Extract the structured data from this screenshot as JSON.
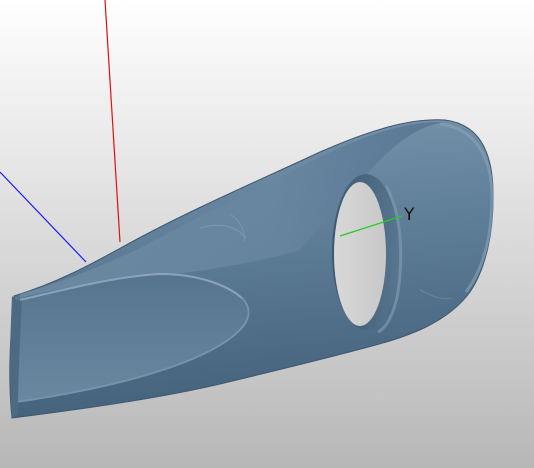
{
  "viewport": {
    "background_top": "#ffffff",
    "background_bottom": "#b8b8b8",
    "model_color": "#5f7e98",
    "model_shadow_color": "#3f5a72",
    "model_highlight_color": "#8ea8bf"
  },
  "axes": {
    "x_axis": {
      "color": "#e01010",
      "label": ""
    },
    "y_axis": {
      "color": "#22cc22",
      "label": "Y"
    },
    "z_axis": {
      "color": "#1a1aff",
      "label": ""
    }
  },
  "model": {
    "name_icon": "3d-scanned-part"
  }
}
